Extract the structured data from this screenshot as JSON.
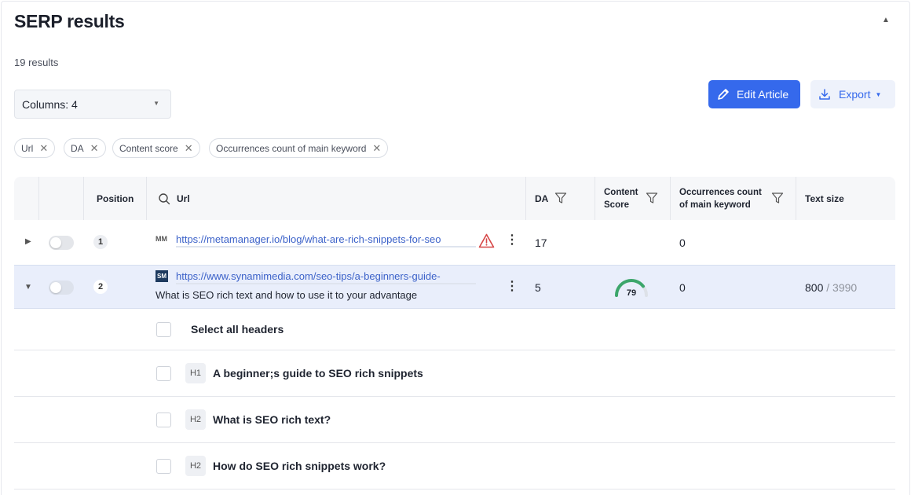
{
  "page": {
    "title": "SERP results",
    "results_count": "19 results"
  },
  "toolbar": {
    "columns_select": "Columns: 4",
    "edit_label": "Edit Article",
    "export_label": "Export"
  },
  "chips": [
    {
      "label": "Url"
    },
    {
      "label": "DA"
    },
    {
      "label": "Content score"
    },
    {
      "label": "Occurrences count of main keyword"
    }
  ],
  "table": {
    "headers": {
      "position": "Position",
      "url": "Url",
      "da": "DA",
      "content_score_1": "Content",
      "content_score_2": "Score",
      "occurrences_1": "Occurrences count",
      "occurrences_2": "of main keyword",
      "text_size": "Text size"
    },
    "rows": [
      {
        "position": "1",
        "favicon_text": "MM",
        "url": "https://metamanager.io/blog/what-are-rich-snippets-for-seo",
        "da": "17",
        "occurrences": "0",
        "warning": true
      },
      {
        "position": "2",
        "favicon_text": "SM",
        "url": "https://www.synamimedia.com/seo-tips/a-beginners-guide-",
        "subtitle": "What is SEO rich text and how to use it to your advantage",
        "da": "5",
        "content_score": 79,
        "occurrences": "0",
        "text_size": "800",
        "text_size_total": "/ 3990"
      }
    ]
  },
  "headers_panel": {
    "select_all": "Select all headers",
    "items": [
      {
        "tag": "H1",
        "text": "A beginner;s guide to SEO rich snippets"
      },
      {
        "tag": "H2",
        "text": "What is SEO rich text?"
      },
      {
        "tag": "H2",
        "text": "How do SEO rich snippets work?"
      }
    ]
  },
  "colors": {
    "accent": "#3569ec",
    "title_highlight": "#f5d33b",
    "gauge_good": "#3ca66b",
    "warning": "#d64545"
  }
}
